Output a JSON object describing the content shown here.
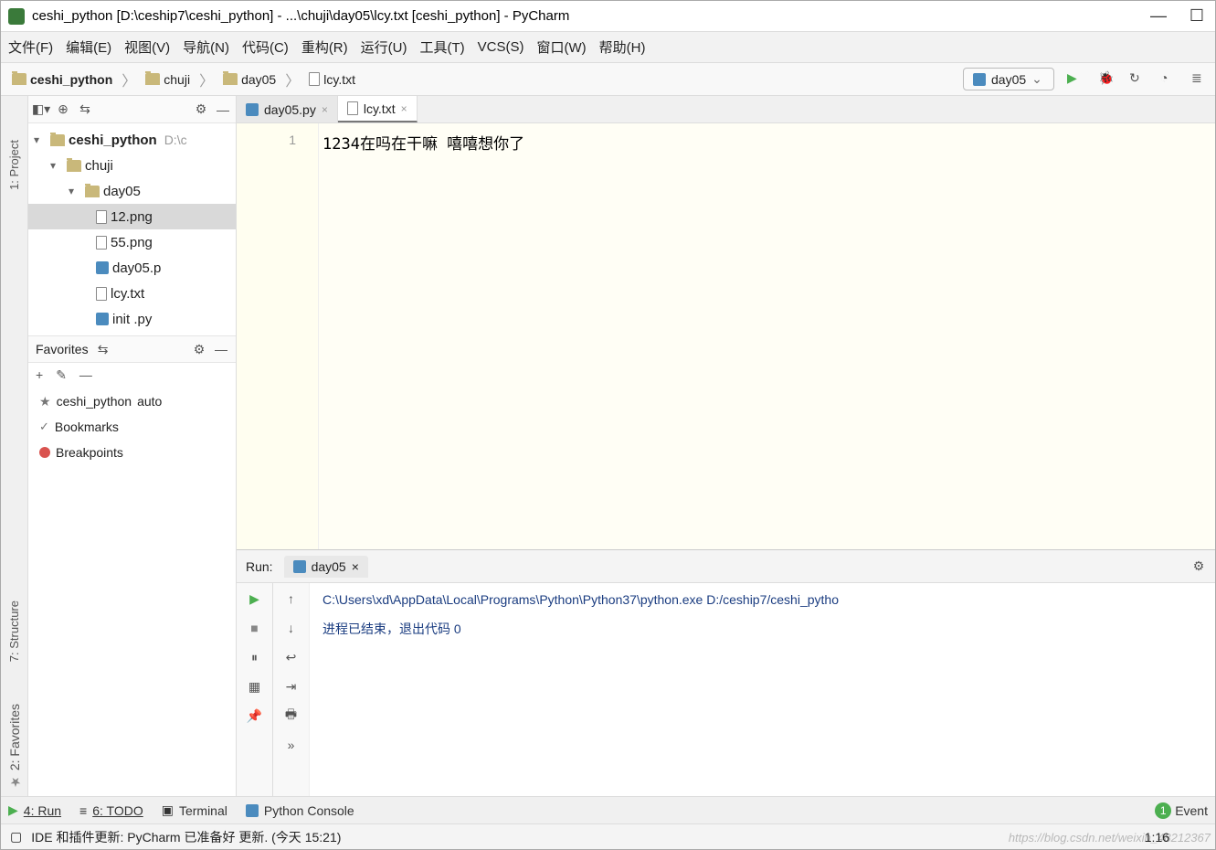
{
  "title": "ceshi_python [D:\\ceship7\\ceshi_python] - ...\\chuji\\day05\\lcy.txt [ceshi_python] - PyCharm",
  "menu": {
    "file": "文件(F)",
    "edit": "编辑(E)",
    "view": "视图(V)",
    "nav": "导航(N)",
    "code": "代码(C)",
    "refactor": "重构(R)",
    "run": "运行(U)",
    "tools": "工具(T)",
    "vcs": "VCS(S)",
    "window": "窗口(W)",
    "help": "帮助(H)"
  },
  "breadcrumb": {
    "p0": "ceshi_python",
    "p1": "chuji",
    "p2": "day05",
    "p3": "lcy.txt"
  },
  "runConfig": {
    "name": "day05"
  },
  "project": {
    "root": "ceshi_python",
    "rootSuffix": "D:\\c",
    "n1": "chuji",
    "n2": "day05",
    "f1": "12.png",
    "f2": "55.png",
    "f3": "day05.p",
    "f4": "lcy.txt",
    "f5": "init   .py"
  },
  "favorites": {
    "title": "Favorites",
    "i1": "ceshi_python",
    "i1s": "auto",
    "i2": "Bookmarks",
    "i3": "Breakpoints"
  },
  "sideRail": {
    "project": "1: Project",
    "structure": "7: Structure",
    "favorites": "2: Favorites"
  },
  "tabs": {
    "t1": "day05.py",
    "t2": "lcy.txt"
  },
  "editor": {
    "line": "1",
    "text": "1234在吗在干嘛 嘻嘻想你了"
  },
  "runPanel": {
    "label": "Run:",
    "tab": "day05",
    "line1": "C:\\Users\\xd\\AppData\\Local\\Programs\\Python\\Python37\\python.exe D:/ceship7/ceshi_pytho",
    "line2": "进程已结束，退出代码 0"
  },
  "bottomTabs": {
    "run": "4: Run",
    "todo": "6: TODO",
    "terminal": "Terminal",
    "pyconsole": "Python Console",
    "event": "Event",
    "eventCount": "1"
  },
  "status": {
    "msg": "IDE 和插件更新: PyCharm 已准备好 更新. (今天 15:21)",
    "pos": "1:16"
  },
  "watermark": "https://blog.csdn.net/weixin_48212367"
}
